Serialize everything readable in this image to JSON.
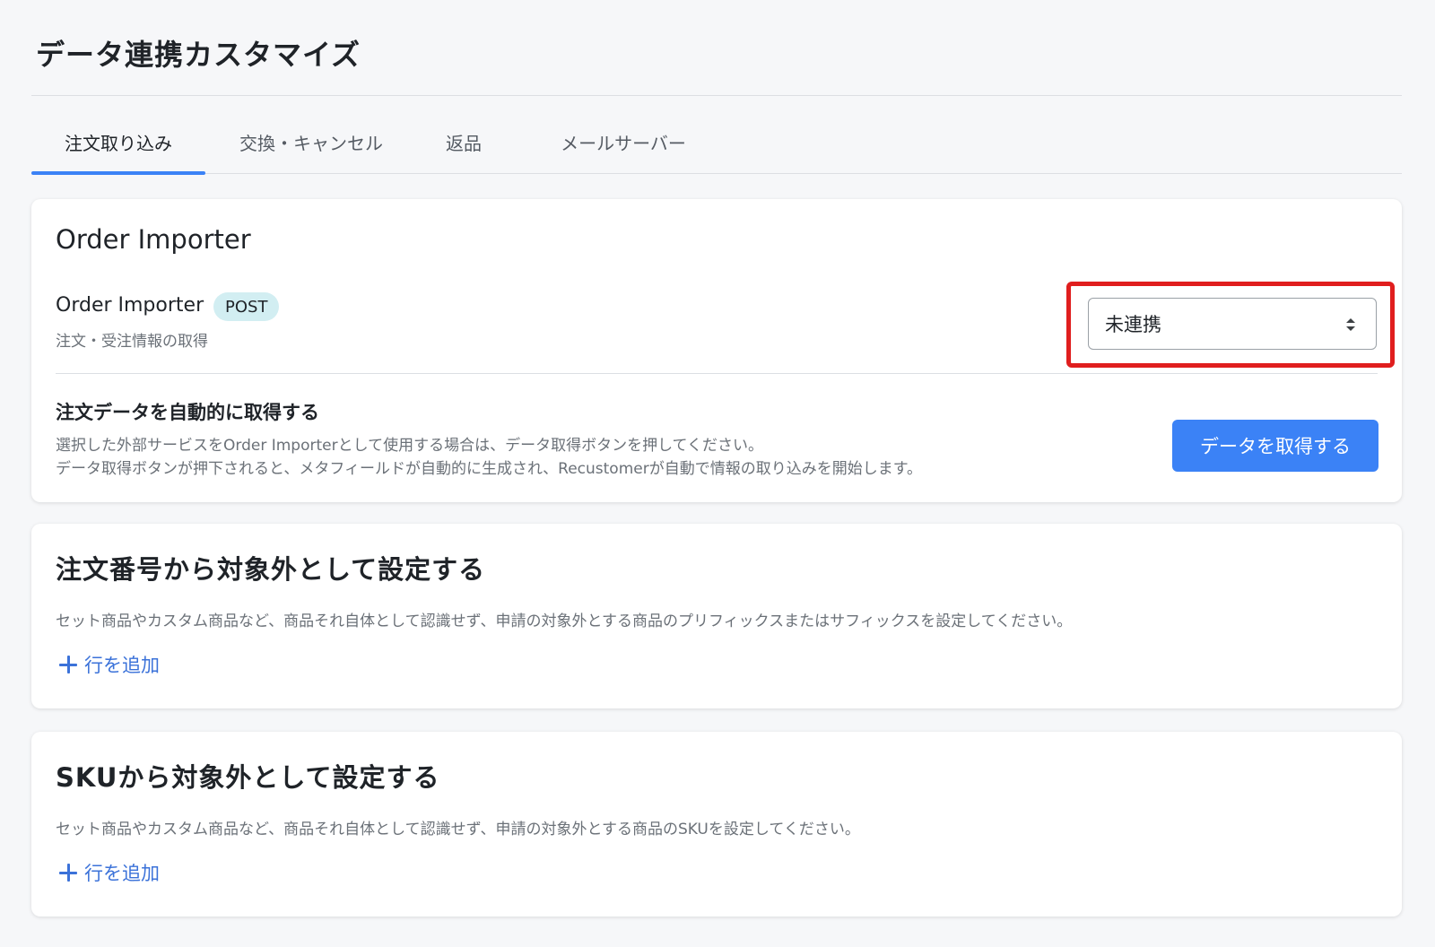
{
  "page": {
    "title": "データ連携カスタマイズ"
  },
  "tabs": [
    {
      "label": "注文取り込み",
      "active": true
    },
    {
      "label": "交換・キャンセル",
      "active": false
    },
    {
      "label": "返品",
      "active": false
    },
    {
      "label": "メールサーバー",
      "active": false
    }
  ],
  "order_importer": {
    "card_title": "Order Importer",
    "name": "Order Importer",
    "badge": "POST",
    "subtitle": "注文・受注情報の取得",
    "select_value": "未連携",
    "auto_fetch": {
      "title": "注文データを自動的に取得する",
      "desc_line1": "選択した外部サービスをOrder Importerとして使用する場合は、データ取得ボタンを押してください。",
      "desc_line2": "データ取得ボタンが押下されると、メタフィールドが自動的に生成され、Recustomerが自動で情報の取り込みを開始します。",
      "button_label": "データを取得する"
    }
  },
  "exclude_by_order_number": {
    "title": "注文番号から対象外として設定する",
    "description": "セット商品やカスタム商品など、商品それ自体として認識せず、申請の対象外とする商品のプリフィックスまたはサフィックスを設定してください。",
    "add_row_label": "行を追加"
  },
  "exclude_by_sku": {
    "title": "SKUから対象外として設定する",
    "description": "セット商品やカスタム商品など、商品それ自体として認識せず、申請の対象外とする商品のSKUを設定してください。",
    "add_row_label": "行を追加"
  },
  "colors": {
    "accent": "#3b82f6",
    "link": "#3b72d9",
    "highlight": "#e01e1e",
    "badge_bg": "#d2eef2"
  }
}
